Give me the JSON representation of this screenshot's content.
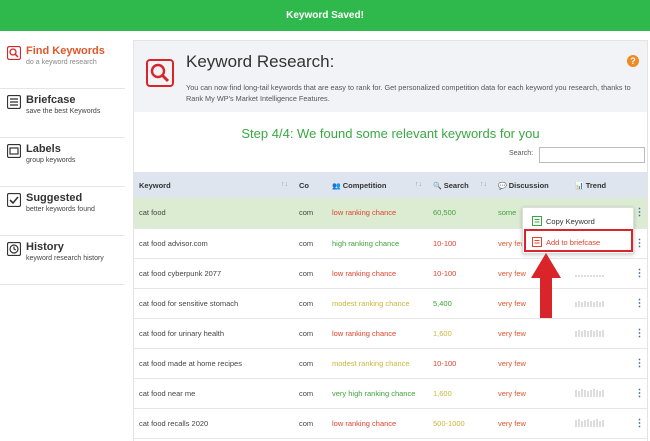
{
  "banner": {
    "text": "Keyword Saved!"
  },
  "sidebar": {
    "items": [
      {
        "title": "Find Keywords",
        "sub": "do a keyword research"
      },
      {
        "title": "Briefcase",
        "sub": "save the best Keywords"
      },
      {
        "title": "Labels",
        "sub": "group keywords"
      },
      {
        "title": "Suggested",
        "sub": "better keywords found"
      },
      {
        "title": "History",
        "sub": "keyword research history"
      }
    ]
  },
  "header": {
    "title": "Keyword Research:",
    "desc": "You can now find long-tail keywords that are easy to rank for. Get personalized competition data for each keyword you research, thanks to Rank My WP's Market Intelligence Features.",
    "help": "?"
  },
  "step": "Step 4/4: We found some relevant keywords for you",
  "search": {
    "label": "Search:",
    "value": ""
  },
  "table": {
    "headers": {
      "keyword": "Keyword",
      "country": "Co",
      "competition": "Competition",
      "search": "Search",
      "discussion": "Discussion",
      "trend": "Trend"
    },
    "rows": [
      {
        "keyword": "cat food",
        "country": "com",
        "competition": "low ranking chance",
        "search": "60,500",
        "discussion": "some"
      },
      {
        "keyword": "cat food advisor.com",
        "country": "com",
        "competition": "high ranking chance",
        "search": "10-100",
        "discussion": "very few"
      },
      {
        "keyword": "cat food cyberpunk 2077",
        "country": "com",
        "competition": "low ranking chance",
        "search": "10-100",
        "discussion": "very few"
      },
      {
        "keyword": "cat food for sensitive stomach",
        "country": "com",
        "competition": "modest ranking chance",
        "search": "5,400",
        "discussion": "very few"
      },
      {
        "keyword": "cat food for urinary health",
        "country": "com",
        "competition": "low ranking chance",
        "search": "1,600",
        "discussion": "very few"
      },
      {
        "keyword": "cat food made at home recipes",
        "country": "com",
        "competition": "modest ranking chance",
        "search": "10-100",
        "discussion": "very few"
      },
      {
        "keyword": "cat food near me",
        "country": "com",
        "competition": "very high ranking chance",
        "search": "1,600",
        "discussion": "very few"
      },
      {
        "keyword": "cat food recalls 2020",
        "country": "com",
        "competition": "low ranking chance",
        "search": "500-1000",
        "discussion": "very few"
      }
    ]
  },
  "menu": {
    "items": [
      {
        "label": "Copy Keyword"
      },
      {
        "label": "Add to briefcase"
      }
    ]
  },
  "colors": {
    "banner": "#2fb94c",
    "accent": "#e0572b",
    "header_bg": "#f1f3f7",
    "table_head": "#dfe5ee",
    "highlight_row": "#dbecd3",
    "arrow": "#d9242a"
  }
}
